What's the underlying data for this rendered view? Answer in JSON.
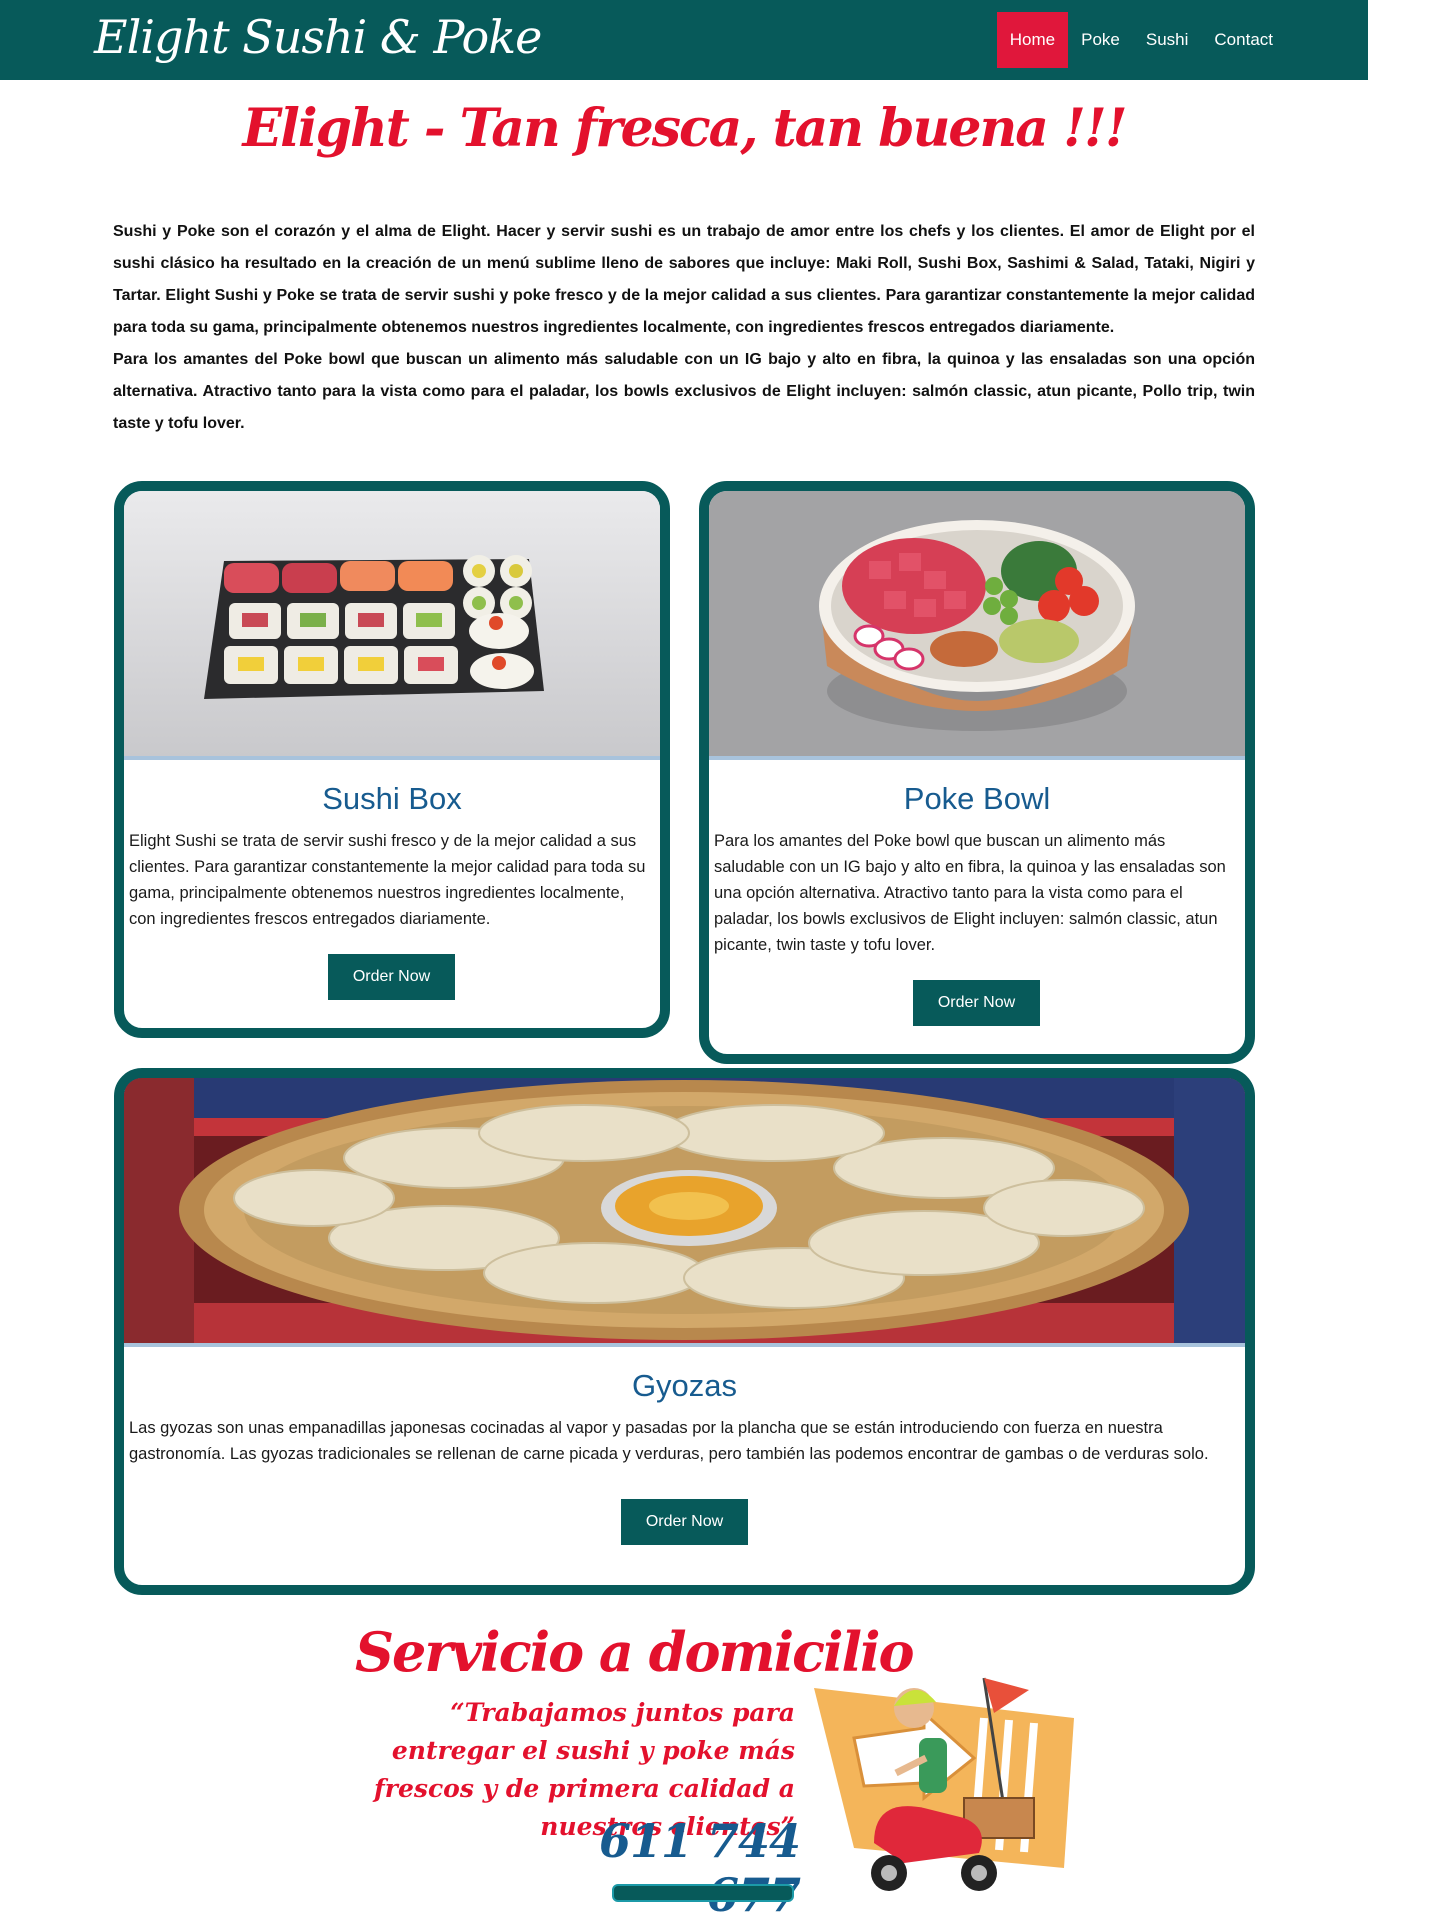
{
  "header": {
    "brand": "Elight Sushi & Poke",
    "nav": [
      {
        "label": "Home"
      },
      {
        "label": "Poke"
      },
      {
        "label": "Sushi"
      },
      {
        "label": "Contact"
      }
    ]
  },
  "hero": {
    "tagline": "Elight - Tan fresca, tan buena !!!"
  },
  "intro": {
    "paragraph_1": "Sushi y Poke son el corazón y el alma de Elight. Hacer y servir sushi es un trabajo de amor entre los chefs y los clientes. El amor de Elight por el sushi clásico ha resultado en la creación de un menú sublime lleno de sabores que incluye: Maki Roll, Sushi Box, Sashimi & Salad, Tataki, Nigiri y Tartar.  Elight Sushi  y Poke se trata de servir sushi y  poke fresco y de la mejor calidad a sus clientes. Para garantizar constantemente la mejor calidad para toda su gama, principalmente obtenemos nuestros ingredientes localmente, con ingredientes frescos entregados diariamente.",
    "paragraph_2": "Para los amantes del Poke bowl que buscan un alimento más saludable con un IG bajo y alto en fibra, la quinoa y las ensaladas son una opción alternativa. Atractivo tanto para la vista como para el paladar, los bowls exclusivos de Elight incluyen: salmón classic, atun picante, Pollo trip, twin taste y tofu lover."
  },
  "cards": [
    {
      "title": "Sushi Box",
      "text": "Elight Sushi se trata de servir sushi fresco y de la mejor calidad a sus clientes. Para garantizar constantemente la mejor calidad para toda su gama, principalmente obtenemos nuestros ingredientes localmente, con ingredientes frescos entregados diariamente.",
      "button": "Order Now"
    },
    {
      "title": "Poke Bowl",
      "text": "Para los amantes del Poke bowl que buscan un alimento más saludable con un IG bajo y alto en fibra, la quinoa y las ensaladas son una opción alternativa. Atractivo tanto para la vista como para el paladar, los bowls exclusivos de Elight incluyen: salmón classic, atun picante, twin taste y tofu lover.",
      "button": "Order Now"
    },
    {
      "title": "Gyozas",
      "text": "Las gyozas son unas empanadillas japonesas cocinadas al vapor y pasadas por la plancha que se están introduciendo con fuerza en nuestra gastronomía. Las gyozas tradicionales se rellenan de carne picada y verduras, pero también las podemos encontrar de gambas o de verduras solo.",
      "button": "Order Now"
    }
  ],
  "delivery": {
    "title": "Servicio a domicilio",
    "quote": "“Trabajamos juntos para entregar el sushi y poke más frescos y de primera calidad a nuestros clientes”",
    "phone": "611 744 677"
  },
  "colors": {
    "primary_teal": "#075a5a",
    "accent_red": "#e3112d",
    "heading_blue": "#175b8f"
  }
}
